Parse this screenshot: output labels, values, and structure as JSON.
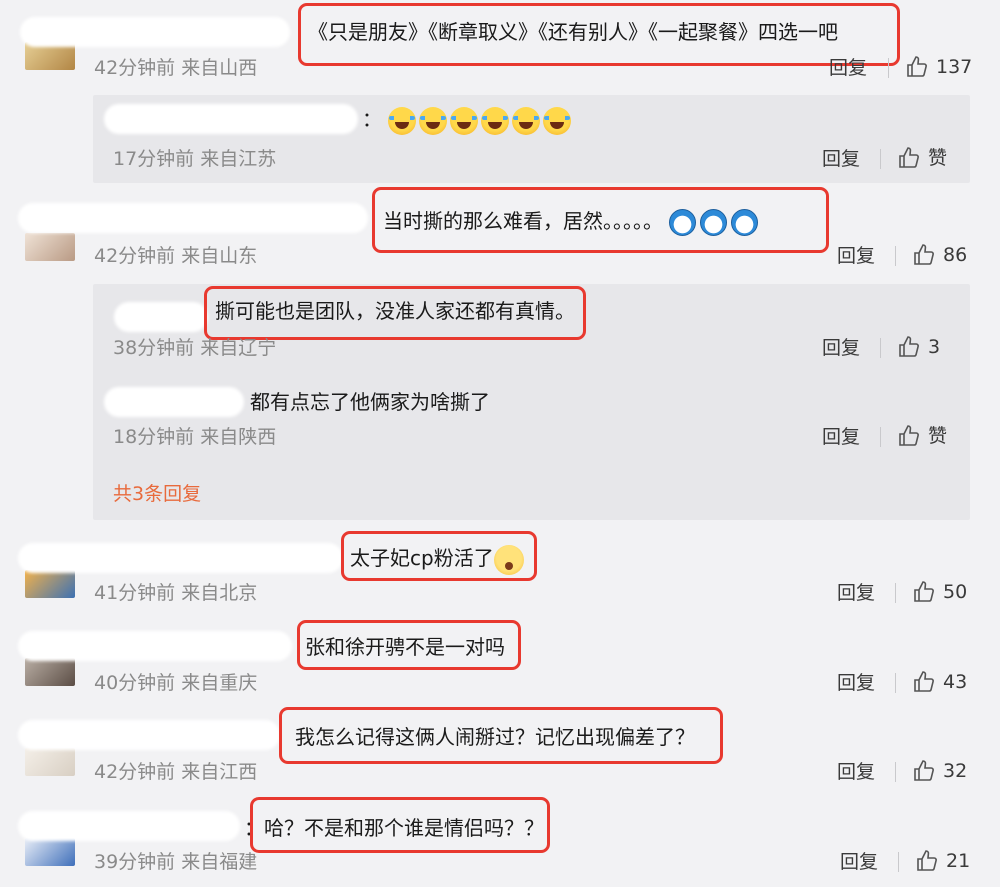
{
  "comments": [
    {
      "text": "《只是朋友》《断章取义》《还有别人》《一起聚餐》四选一吧",
      "time": "42分钟前",
      "location": "来自山西",
      "reply_label": "回复",
      "likes": "137",
      "avatar_color": "#c6a15a",
      "replies": [
        {
          "text": "：",
          "emoji_count": 6,
          "time": "17分钟前",
          "location": "来自江苏",
          "reply_label": "回复",
          "likes": "赞"
        }
      ]
    },
    {
      "text": "当时撕的那么难看，居然。。。。。",
      "time": "42分钟前",
      "location": "来自山东",
      "reply_label": "回复",
      "likes": "86",
      "avatar_color": "#d9c2b0",
      "replies": [
        {
          "text": "撕可能也是团队，没准人家还都有真情。",
          "time": "38分钟前",
          "location": "来自辽宁",
          "reply_label": "回复",
          "likes": "3"
        },
        {
          "text": "都有点忘了他俩家为啥撕了",
          "time": "18分钟前",
          "location": "来自陕西",
          "reply_label": "回复",
          "likes": "赞"
        }
      ],
      "more_replies": "共3条回复"
    },
    {
      "text": "太子妃cp粉活了",
      "time": "41分钟前",
      "location": "来自北京",
      "reply_label": "回复",
      "likes": "50",
      "avatar_color": "#d98a2c"
    },
    {
      "text": "张和徐开骋不是一对吗",
      "time": "40分钟前",
      "location": "来自重庆",
      "reply_label": "回复",
      "likes": "43",
      "avatar_color": "#7a6c64"
    },
    {
      "text": "我怎么记得这俩人闹掰过？记忆出现偏差了？",
      "time": "42分钟前",
      "location": "来自江西",
      "reply_label": "回复",
      "likes": "32",
      "avatar_color": "#e9e3da"
    },
    {
      "text": "哈？不是和那个谁是情侣吗？？",
      "text_prefix": "：",
      "time": "39分钟前",
      "location": "来自福建",
      "reply_label": "回复",
      "likes": "21",
      "avatar_color": "#5a86c8"
    }
  ],
  "colors": {
    "background": "#f2f2f4",
    "reply_panel": "#e7e7ea",
    "highlight_box": "#e8392f",
    "more_link": "#e86a3c",
    "meta_text": "#8a8a8a"
  },
  "icons": {
    "like": "thumbs-up-icon",
    "emoji_laugh": "laugh-cry-emoji-icon",
    "emoji_doraemon": "doraemon-emoji-icon",
    "emoji_shy": "shy-emoji-icon"
  }
}
